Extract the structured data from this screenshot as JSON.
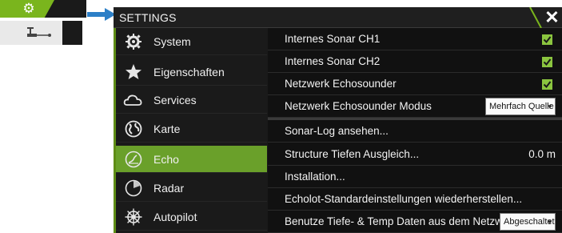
{
  "launcher": {
    "settings_icon": "gear-icon",
    "device_icon": "transducer-icon",
    "accent_color": "#7ab51d"
  },
  "pointer": {
    "icon": "arrow-right-icon",
    "color": "#2c7fc7"
  },
  "dialog": {
    "title": "SETTINGS",
    "close_icon": "close-icon",
    "accent_color": "#6aa02a"
  },
  "categories": [
    {
      "label": "System",
      "icon": "gear-icon",
      "selected": false
    },
    {
      "label": "Eigenschaften",
      "icon": "star-icon",
      "selected": false
    },
    {
      "label": "Services",
      "icon": "cloud-icon",
      "selected": false
    },
    {
      "label": "Karte",
      "icon": "globe-icon",
      "selected": false
    },
    {
      "label": "Echo",
      "icon": "echo-icon",
      "selected": true
    },
    {
      "label": "Radar",
      "icon": "radar-icon",
      "selected": false
    },
    {
      "label": "Autopilot",
      "icon": "helm-icon",
      "selected": false
    }
  ],
  "options": [
    {
      "label": "Internes Sonar CH1",
      "type": "checkbox",
      "checked": true
    },
    {
      "label": "Internes Sonar CH2",
      "type": "checkbox",
      "checked": true
    },
    {
      "label": "Netzwerk Echosounder",
      "type": "checkbox",
      "checked": true
    },
    {
      "label": "Netzwerk Echosounder Modus",
      "type": "dropdown",
      "value": "Mehrfach Quelle"
    },
    {
      "label": "Sonar-Log ansehen...",
      "type": "action"
    },
    {
      "label": "Structure Tiefen Ausgleich...",
      "type": "value",
      "value": "0.0 m"
    },
    {
      "label": "Installation...",
      "type": "action"
    },
    {
      "label": "Echolot-Standardeinstellungen wiederherstellen...",
      "type": "action"
    },
    {
      "label": "Benutze Tiefe- & Temp Daten aus dem Netzwerk",
      "type": "dropdown",
      "value": "Abgeschaltet"
    }
  ]
}
